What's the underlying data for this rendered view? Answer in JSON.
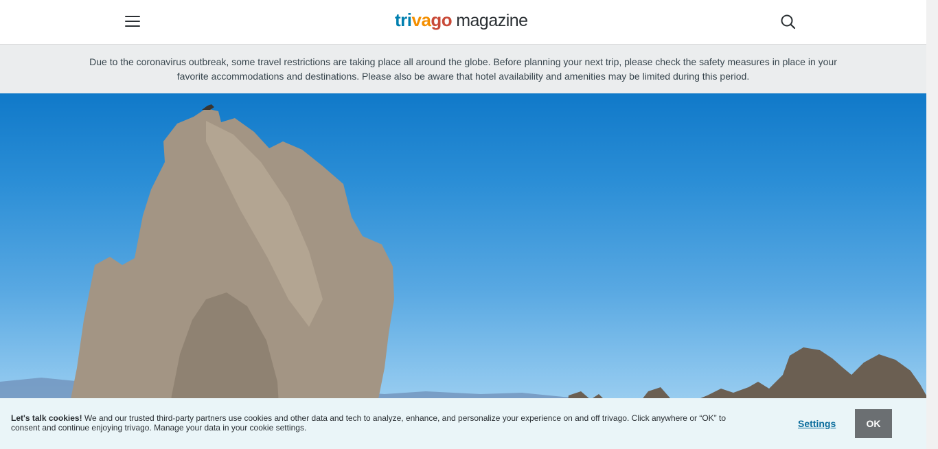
{
  "header": {
    "menu_icon": "hamburger-menu-icon",
    "logo": {
      "part1": "tri",
      "part2": "va",
      "part3": "go",
      "suffix": "magazine"
    },
    "search_icon": "search-icon"
  },
  "notice": {
    "text": "Due to the coronavirus outbreak, some travel restrictions are taking place all around the globe. Before planning your next trip, please check the safety measures in place in your favorite accommodations and destinations. Please also be aware that hotel availability and amenities may be limited during this period."
  },
  "hero": {
    "colors": {
      "sky_top": "#1079c9",
      "sky_bottom": "#b6dbf3",
      "rock": "#a39584"
    }
  },
  "cookie_banner": {
    "heading": "Let's talk cookies!",
    "body": " We and our trusted third-party partners use cookies and other data and tech to analyze, enhance, and personalize your experience on and off trivago. Click anywhere or “OK” to consent and continue enjoying trivago. Manage your data in your cookie settings.",
    "settings_label": "Settings",
    "ok_label": "OK"
  },
  "colors": {
    "brand_blue": "#007faf",
    "brand_orange": "#f48f00",
    "brand_red": "#c94a38",
    "notice_bg": "#ebedee",
    "cookie_bg": "#eaf5f8",
    "ok_button_bg": "#6b6f72"
  }
}
